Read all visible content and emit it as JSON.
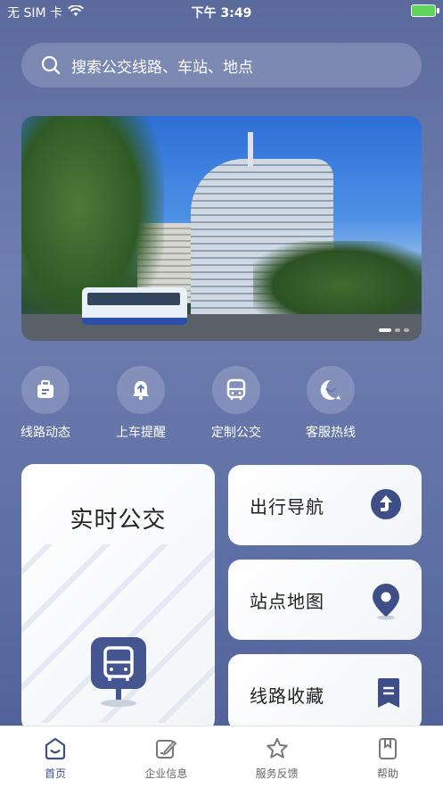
{
  "status_bar": {
    "carrier": "无 SIM 卡",
    "time": "下午 3:49"
  },
  "search": {
    "placeholder": "搜索公交线路、车站、地点"
  },
  "quick_nav": [
    {
      "label": "线路动态",
      "icon": "briefcase-icon"
    },
    {
      "label": "上车提醒",
      "icon": "bell-icon"
    },
    {
      "label": "定制公交",
      "icon": "bus-icon"
    },
    {
      "label": "客服热线",
      "icon": "chat-smile-icon"
    }
  ],
  "cards": {
    "realtime": {
      "title": "实时公交",
      "icon": "bus-pin-icon"
    },
    "navigation": {
      "title": "出行导航",
      "icon": "navigation-arrow-icon"
    },
    "station_map": {
      "title": "站点地图",
      "icon": "map-pin-icon"
    },
    "favorites": {
      "title": "线路收藏",
      "icon": "bookmark-icon"
    }
  },
  "bottom_nav": [
    {
      "label": "首页",
      "icon": "home-icon",
      "active": true
    },
    {
      "label": "企业信息",
      "icon": "edit-icon",
      "active": false
    },
    {
      "label": "服务反馈",
      "icon": "star-icon",
      "active": false
    },
    {
      "label": "帮助",
      "icon": "book-icon",
      "active": false
    }
  ],
  "colors": {
    "accent": "#3d4f86",
    "background_top": "#5b6a9c",
    "background_bottom": "#4f5f96"
  }
}
